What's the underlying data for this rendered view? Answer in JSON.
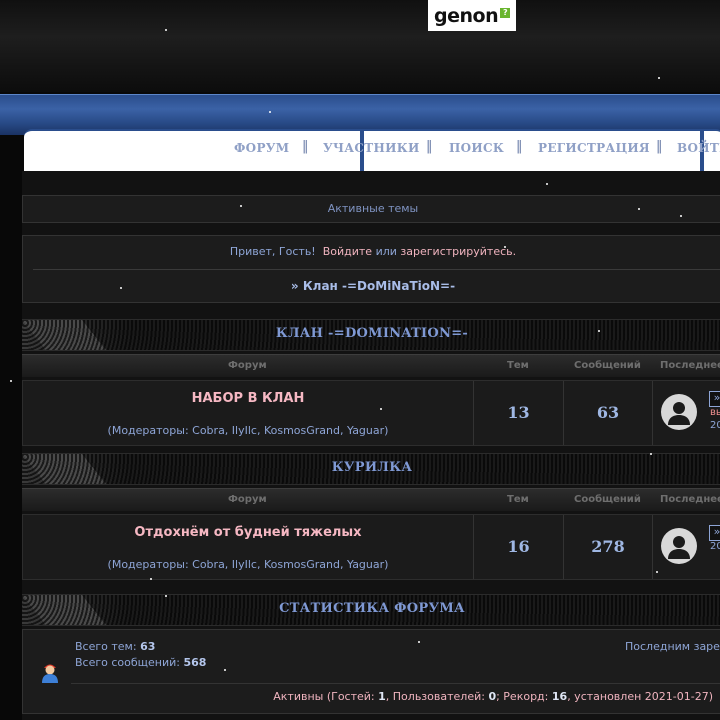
{
  "logo": {
    "text": "genon",
    "badge": "?"
  },
  "nav": {
    "items": [
      "ФОРУМ",
      "УЧАСТНИКИ",
      "ПОИСК",
      "РЕГИСТРАЦИЯ",
      "ВОЙТИ"
    ],
    "separator": "‖"
  },
  "active_topics": "Активные темы",
  "greeting": {
    "hello": "Привет, Гость!",
    "login": "Войдите",
    "or": "или",
    "register": "зарегистрируйтесь.",
    "breadcrumb": "» Клан -=DoMiNaTioN=-"
  },
  "columns": {
    "forum": "Форум",
    "topics": "Тем",
    "posts": "Сообщений",
    "last": "Последнее"
  },
  "categories": [
    {
      "title": "КЛАН -=DOMINATION=-",
      "forum": {
        "name": "НАБОР В КЛАН",
        "moderators": "(Модераторы: Cobra, IlyIlc, KosmosGrand, Yaguar)",
        "topics": "13",
        "posts": "63",
        "last_post_arrow": "»",
        "last_post_user": "вы",
        "last_post_date": "20"
      }
    },
    {
      "title": "КУРИЛКА",
      "forum": {
        "name": "Отдохнём от будней тяжелых",
        "moderators": "(Модераторы: Cobra, IlyIlc, KosmosGrand, Yaguar)",
        "topics": "16",
        "posts": "278",
        "last_post_arrow": "»",
        "last_post_user": "",
        "last_post_date": "20"
      }
    }
  ],
  "stats": {
    "title": "СТАТИСТИКА ФОРУМА",
    "topics_label": "Всего тем:",
    "topics_value": "63",
    "posts_label": "Всего сообщений:",
    "posts_value": "568",
    "last_registered": "Последним зарег",
    "online_prefix": "Активны (Гостей:",
    "guests": "1",
    "users_label": ", Пользователей:",
    "users": "0",
    "record_label": "; Рекорд:",
    "record": "16",
    "record_suffix": ", установлен 2021-01-27)"
  },
  "colors": {
    "accent_blue": "#8ea5d6",
    "pink": "#f0b4bf",
    "nav_blue": "#2a4d8c"
  },
  "icons": [
    "user-avatar-icon",
    "stats-user-icon",
    "arrow-icon"
  ]
}
